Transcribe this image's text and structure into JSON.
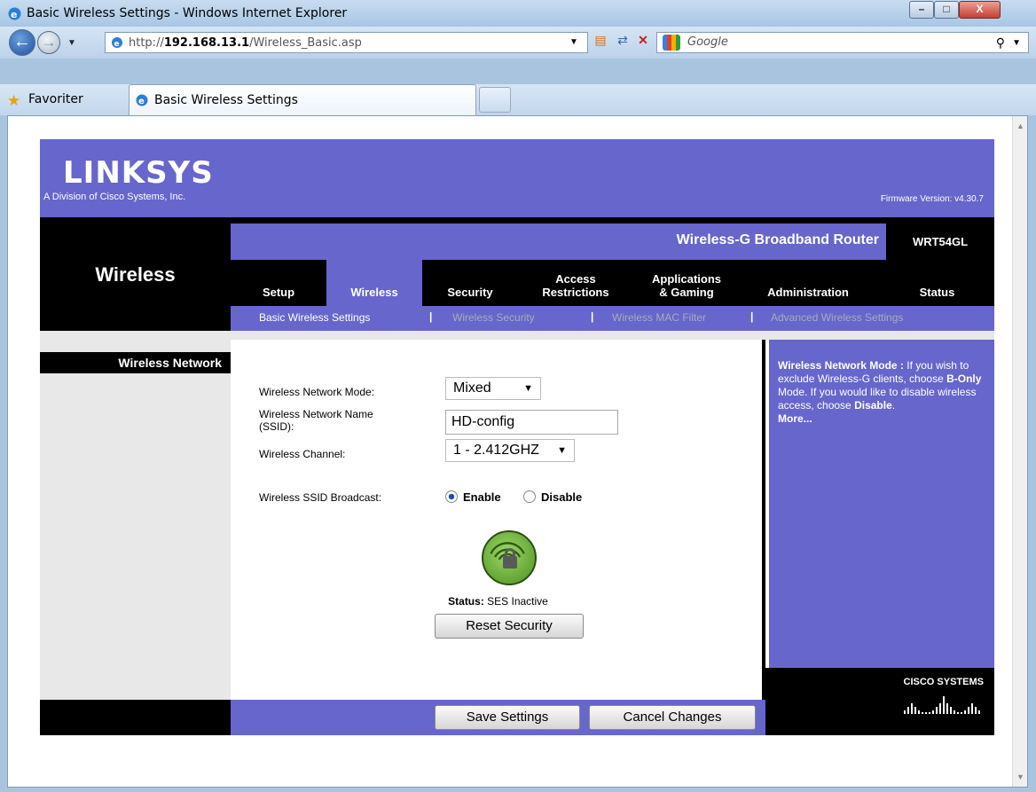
{
  "window": {
    "title": "Basic Wireless Settings - Windows Internet Explorer",
    "minimize": "–",
    "maximize": "□",
    "close": "X"
  },
  "address": {
    "url_prefix": "http://",
    "url_host": "192.168.13.1",
    "url_path": "/Wireless_Basic.asp",
    "search_placeholder": "Google"
  },
  "tabs": {
    "favorites_label": "Favoriter",
    "active_tab_label": "Basic Wireless Settings"
  },
  "header": {
    "logo": "LINKSYS",
    "logo_sub": "A Division of Cisco Systems, Inc.",
    "firmware": "Firmware Version: v4.30.7",
    "product_name": "Wireless-G Broadband Router",
    "model": "WRT54GL",
    "section_title": "Wireless"
  },
  "nav": {
    "tabs": [
      {
        "label": "Setup"
      },
      {
        "label": "Wireless"
      },
      {
        "label": "Security"
      },
      {
        "label": "Access\nRestrictions"
      },
      {
        "label": "Applications\n& Gaming"
      },
      {
        "label": "Administration"
      },
      {
        "label": "Status"
      }
    ],
    "subtabs": [
      {
        "label": "Basic Wireless Settings"
      },
      {
        "label": "Wireless Security"
      },
      {
        "label": "Wireless MAC Filter"
      },
      {
        "label": "Advanced Wireless Settings"
      }
    ],
    "separator": "|"
  },
  "form": {
    "section_label": "Wireless Network",
    "mode_label": "Wireless Network Mode:",
    "mode_value": "Mixed",
    "ssid_label": "Wireless Network Name (SSID):",
    "ssid_value": "HD-config",
    "channel_label": "Wireless Channel:",
    "channel_value": "1 - 2.412GHZ",
    "broadcast_label": "Wireless SSID Broadcast:",
    "enable_label": "Enable",
    "disable_label": "Disable",
    "broadcast_selected": "Enable",
    "ses_status_label": "Status:",
    "ses_status_value": "SES Inactive",
    "reset_button": "Reset Security",
    "save_button": "Save Settings",
    "cancel_button": "Cancel Changes"
  },
  "help": {
    "title": "Wireless Network Mode :",
    "text_1": "If you wish to exclude Wireless-G clients, choose",
    "bold_1": "B-Only",
    "text_2": "Mode. If you would like to disable wireless access, choose",
    "bold_2": "Disable",
    "text_3": ".",
    "more": "More..."
  },
  "footer": {
    "cisco": "CISCO SYSTEMS"
  },
  "colors": {
    "linksys_purple": "#6666cc",
    "black": "#000000",
    "panel_gray": "#e8e8e8"
  }
}
